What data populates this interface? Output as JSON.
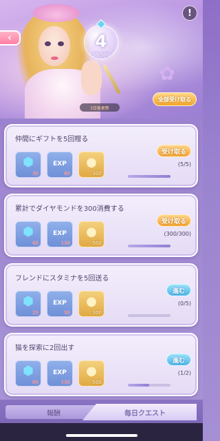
{
  "header": {
    "bubble_number": "4",
    "bubble_count": "30/300",
    "tag_text": "3日後更新",
    "claim_all_label": "全部受け取る"
  },
  "quests": [
    {
      "title": "仲間にギフトを5回贈る",
      "rewards": [
        {
          "icon": "gem-icon",
          "qty": "30"
        },
        {
          "icon": "exp-icon",
          "label": "EXP",
          "qty": "60"
        },
        {
          "icon": "coin-icon",
          "qty": "300"
        }
      ],
      "action": "受け取る",
      "action_type": "claim",
      "progress": "(5/5)",
      "progress_ratio": 1.0
    },
    {
      "title": "累計でダイヤモンドを300消費する",
      "rewards": [
        {
          "icon": "gem-icon",
          "qty": "65"
        },
        {
          "icon": "exp-icon",
          "label": "EXP",
          "qty": "130"
        },
        {
          "icon": "coin-icon",
          "qty": "500"
        }
      ],
      "action": "受け取る",
      "action_type": "claim",
      "progress": "(300/300)",
      "progress_ratio": 1.0
    },
    {
      "title": "フレンドにスタミナを5回送る",
      "rewards": [
        {
          "icon": "gem-icon",
          "qty": "25"
        },
        {
          "icon": "exp-icon",
          "label": "EXP",
          "qty": "50"
        },
        {
          "icon": "coin-icon",
          "qty": "300"
        }
      ],
      "action": "進む",
      "action_type": "go",
      "progress": "(0/5)",
      "progress_ratio": 0.0
    },
    {
      "title": "猫を探索に2回出す",
      "rewards": [
        {
          "icon": "gem-icon",
          "qty": "65"
        },
        {
          "icon": "exp-icon",
          "label": "EXP",
          "qty": "130"
        },
        {
          "icon": "coin-icon",
          "qty": "500"
        }
      ],
      "action": "進む",
      "action_type": "go",
      "progress": "(1/2)",
      "progress_ratio": 0.5
    }
  ],
  "tabs": {
    "left": "報酬",
    "right": "毎日クエスト"
  },
  "colors": {
    "claim_button": "#f4a232",
    "go_button": "#4fb3e6",
    "card_bg": "#f3eefc",
    "page_bg": "#9c83cf"
  }
}
